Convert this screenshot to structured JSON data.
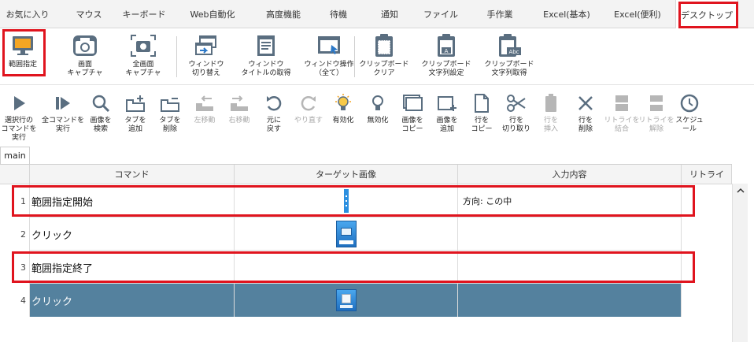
{
  "category_tabs": [
    {
      "label": "お気に入り"
    },
    {
      "label": "マウス"
    },
    {
      "label": "キーボード"
    },
    {
      "label": "Web自動化"
    },
    {
      "label": "高度機能"
    },
    {
      "label": "待機"
    },
    {
      "label": "通知"
    },
    {
      "label": "ファイル"
    },
    {
      "label": "手作業"
    },
    {
      "label": "Excel(基本)"
    },
    {
      "label": "Excel(便利)"
    },
    {
      "label": "デスクトップ"
    }
  ],
  "active_category": "デスクトップ",
  "ribbon": {
    "items": [
      {
        "label": "範囲指定",
        "icon": "monitor-select-icon"
      },
      {
        "label": "画面\nキャプチャ",
        "icon": "camera-icon"
      },
      {
        "label": "全画面\nキャプチャ",
        "icon": "fullscreen-camera-icon"
      },
      {
        "label": "ウィンドウ\n切り替え",
        "icon": "window-switch-icon"
      },
      {
        "label": "ウィンドウ\nタイトルの取得",
        "icon": "window-title-icon"
      },
      {
        "label": "ウィンドウ操作\n（全て）",
        "icon": "window-operation-icon"
      },
      {
        "label": "クリップボード\nクリア",
        "icon": "clipboard-clear-icon"
      },
      {
        "label": "クリップボード\n文字列設定",
        "icon": "clipboard-set-icon"
      },
      {
        "label": "クリップボード\n文字列取得",
        "icon": "clipboard-get-icon"
      }
    ]
  },
  "toolbar": {
    "items": [
      {
        "label": "選択行の\nコマンドを実行",
        "icon": "play-icon",
        "enabled": true
      },
      {
        "label": "全コマンドを\n実行",
        "icon": "play-all-icon",
        "enabled": true
      },
      {
        "label": "画像を\n検索",
        "icon": "magnifier-icon",
        "enabled": true
      },
      {
        "label": "タブを\n追加",
        "icon": "tab-add-icon",
        "enabled": true
      },
      {
        "label": "タブを\n削除",
        "icon": "tab-delete-icon",
        "enabled": true
      },
      {
        "label": "左移動",
        "icon": "move-left-icon",
        "enabled": false
      },
      {
        "label": "右移動",
        "icon": "move-right-icon",
        "enabled": false
      },
      {
        "label": "元に\n戻す",
        "icon": "undo-icon",
        "enabled": true
      },
      {
        "label": "やり直す",
        "icon": "redo-icon",
        "enabled": false
      },
      {
        "label": "有効化",
        "icon": "bulb-on-icon",
        "enabled": true
      },
      {
        "label": "無効化",
        "icon": "bulb-off-icon",
        "enabled": true
      },
      {
        "label": "画像を\nコピー",
        "icon": "image-copy-icon",
        "enabled": true
      },
      {
        "label": "画像を\n追加",
        "icon": "image-add-icon",
        "enabled": true
      },
      {
        "label": "行を\nコピー",
        "icon": "row-copy-icon",
        "enabled": true
      },
      {
        "label": "行を\n切り取り",
        "icon": "scissors-icon",
        "enabled": true
      },
      {
        "label": "行を\n挿入",
        "icon": "row-insert-icon",
        "enabled": false
      },
      {
        "label": "行を\n削除",
        "icon": "close-icon",
        "enabled": true
      },
      {
        "label": "リトライを\n結合",
        "icon": "retry-merge-icon",
        "enabled": false
      },
      {
        "label": "リトライを\n解除",
        "icon": "retry-split-icon",
        "enabled": false
      },
      {
        "label": "スケジュール",
        "icon": "clock-icon",
        "enabled": true
      }
    ]
  },
  "sheet_tabs": [
    {
      "label": "main"
    }
  ],
  "grid": {
    "columns": {
      "command": "コマンド",
      "target": "ターゲット画像",
      "input": "入力内容",
      "retry": "リトライ"
    },
    "rows": [
      {
        "num": "1",
        "command": "範囲指定開始",
        "input": "方向: この中",
        "target_icon": "region-marker-icon",
        "selected": false
      },
      {
        "num": "2",
        "command": "クリック",
        "input": "",
        "target_icon": "desktop-thumbnail-icon",
        "selected": false
      },
      {
        "num": "3",
        "command": "範囲指定終了",
        "input": "",
        "target_icon": "",
        "selected": false
      },
      {
        "num": "4",
        "command": "クリック",
        "input": "",
        "target_icon": "app-thumbnail-icon",
        "selected": true
      }
    ]
  },
  "colors": {
    "highlight": "#e0141e",
    "selected_row": "#54819e",
    "accent_blue": "#2b78c8"
  }
}
